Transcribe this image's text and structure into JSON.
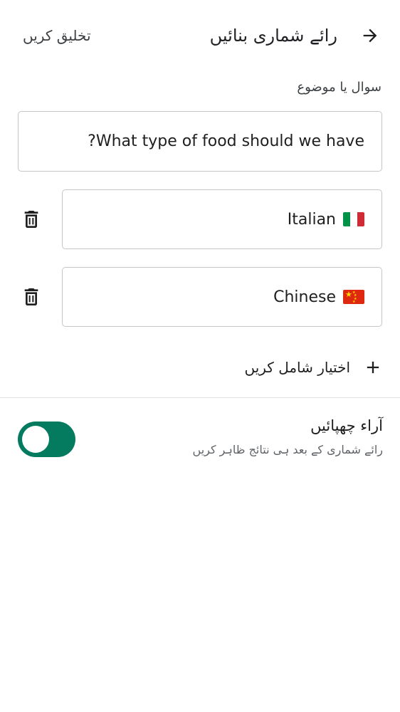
{
  "header": {
    "title": "رائے شماری بنائیں",
    "create_label": "تخلیق کریں"
  },
  "question": {
    "label": "سوال یا موضوع",
    "value": "?What type of food should we have"
  },
  "options": [
    {
      "text": "Italian",
      "flag": "flag-italy-icon"
    },
    {
      "text": "Chinese",
      "flag": "flag-china-icon"
    }
  ],
  "add_option": {
    "label": "اختیار شامل کریں"
  },
  "hide_votes": {
    "title": "آراء چھپائیں",
    "subtitle": "رائے شماری کے بعد ہی نتائج ظاہر کریں",
    "enabled": true
  },
  "colors": {
    "toggle_on": "#047b5f",
    "border": "#c4c7c5"
  }
}
